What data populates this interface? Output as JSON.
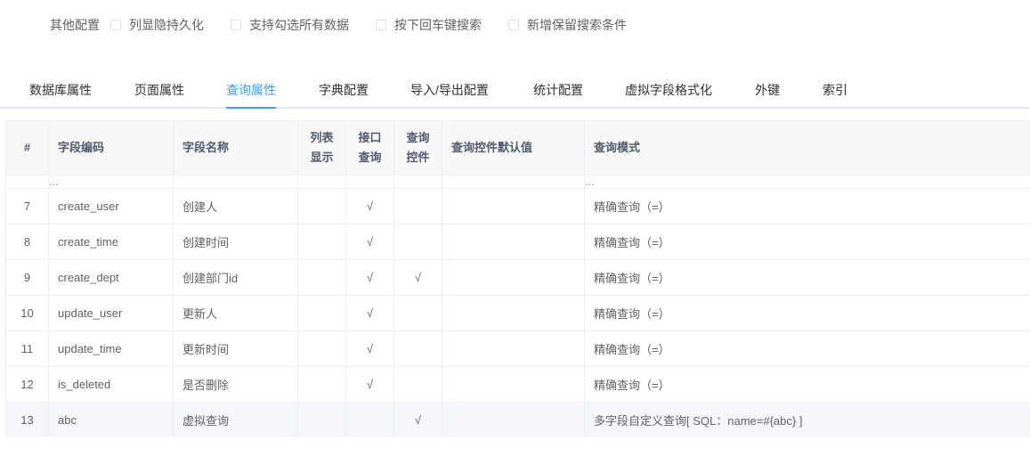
{
  "options": {
    "label": "其他配置",
    "checkboxes": [
      {
        "label": "列显隐持久化",
        "checked": false
      },
      {
        "label": "支持勾选所有数据",
        "checked": false
      },
      {
        "label": "按下回车键搜索",
        "checked": false
      },
      {
        "label": "新增保留搜索条件",
        "checked": false
      }
    ]
  },
  "tabs": [
    {
      "label": "数据库属性",
      "active": false
    },
    {
      "label": "页面属性",
      "active": false
    },
    {
      "label": "查询属性",
      "active": true
    },
    {
      "label": "字典配置",
      "active": false
    },
    {
      "label": "导入/导出配置",
      "active": false
    },
    {
      "label": "统计配置",
      "active": false
    },
    {
      "label": "虚拟字段格式化",
      "active": false
    },
    {
      "label": "外键",
      "active": false
    },
    {
      "label": "索引",
      "active": false
    }
  ],
  "colors": {
    "accent": "#409eff",
    "border": "#ebeef5",
    "header_bg": "#f8f8f9",
    "highlight_bg": "#f5f7fa"
  },
  "table": {
    "headers": [
      "#",
      "字段编码",
      "字段名称",
      "列表\n显示",
      "接口\n查询",
      "查询\n控件",
      "查询控件默认值",
      "查询模式"
    ],
    "partial_row": {
      "code": "...",
      "mode": "..."
    },
    "rows": [
      {
        "no": "7",
        "code": "create_user",
        "name": "创建人",
        "list": "",
        "api": "√",
        "ctrl": "",
        "def": "",
        "mode": "精确查询（=）"
      },
      {
        "no": "8",
        "code": "create_time",
        "name": "创建时间",
        "list": "",
        "api": "√",
        "ctrl": "",
        "def": "",
        "mode": "精确查询（=）"
      },
      {
        "no": "9",
        "code": "create_dept",
        "name": "创建部门id",
        "list": "",
        "api": "√",
        "ctrl": "√",
        "def": "",
        "mode": "精确查询（=）"
      },
      {
        "no": "10",
        "code": "update_user",
        "name": "更新人",
        "list": "",
        "api": "√",
        "ctrl": "",
        "def": "",
        "mode": "精确查询（=）"
      },
      {
        "no": "11",
        "code": "update_time",
        "name": "更新时间",
        "list": "",
        "api": "√",
        "ctrl": "",
        "def": "",
        "mode": "精确查询（=）"
      },
      {
        "no": "12",
        "code": "is_deleted",
        "name": "是否删除",
        "list": "",
        "api": "√",
        "ctrl": "",
        "def": "",
        "mode": "精确查询（=）"
      },
      {
        "no": "13",
        "code": "abc",
        "name": "虚拟查询",
        "list": "",
        "api": "",
        "ctrl": "√",
        "def": "",
        "mode": "多字段自定义查询[ SQL：name=#{abc} ]"
      }
    ]
  }
}
